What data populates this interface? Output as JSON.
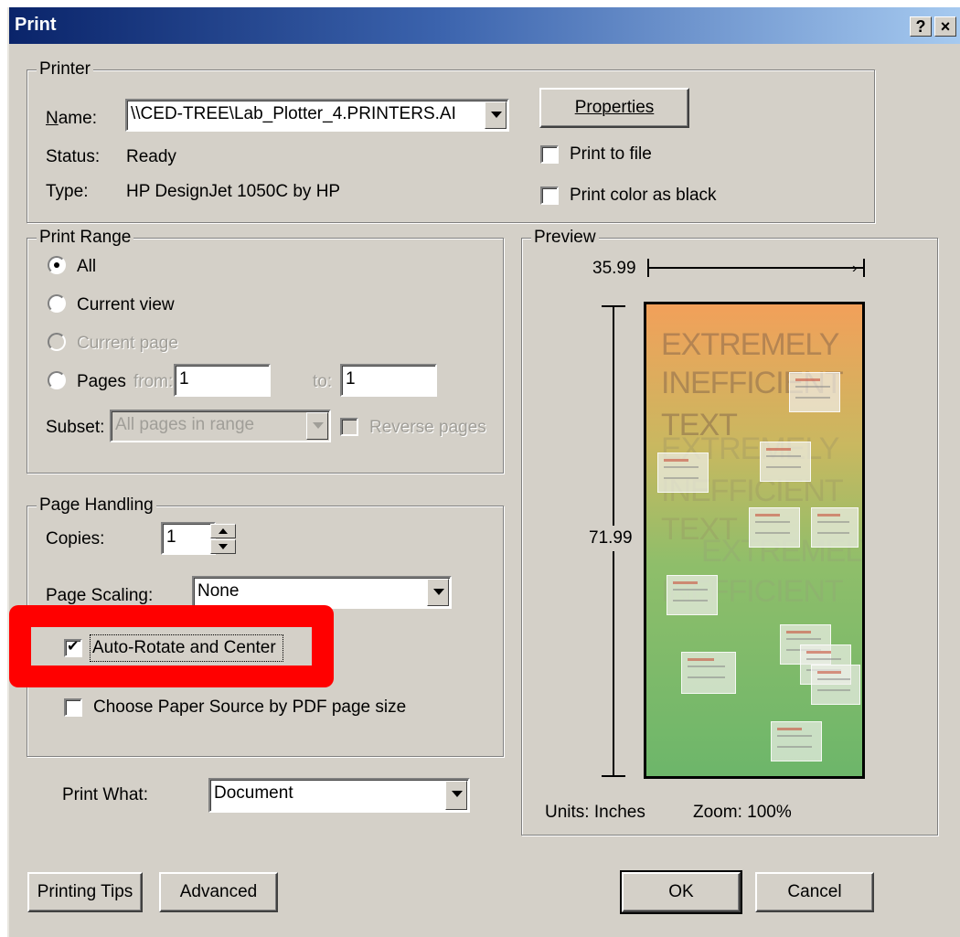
{
  "titlebar": {
    "title": "Print",
    "help_label": "?",
    "close_label": "×"
  },
  "printer": {
    "legend": "Printer",
    "name_label": "Name:",
    "name_value": "\\\\CED-TREE\\Lab_Plotter_4.PRINTERS.AI",
    "status_label": "Status:",
    "status_value": "Ready",
    "type_label": "Type:",
    "type_value": "HP DesignJet 1050C by HP",
    "properties_label": "Properties",
    "print_to_file_label": "Print to file",
    "print_to_file_checked": false,
    "print_color_black_label": "Print color as black",
    "print_color_black_checked": false
  },
  "print_range": {
    "legend": "Print Range",
    "all_label": "All",
    "current_view_label": "Current view",
    "current_page_label": "Current page",
    "pages_label": "Pages",
    "from_label": "from:",
    "from_value": "1",
    "to_label": "to:",
    "to_value": "1",
    "subset_label": "Subset:",
    "subset_value": "All pages in range",
    "reverse_pages_label": "Reverse pages",
    "selected": "All"
  },
  "page_handling": {
    "legend": "Page Handling",
    "copies_label": "Copies:",
    "copies_value": "1",
    "scaling_label": "Page Scaling:",
    "scaling_value": "None",
    "auto_rotate_label": "Auto-Rotate and Center",
    "auto_rotate_checked": true,
    "paper_source_label": "Choose Paper Source by PDF page size",
    "paper_source_checked": false
  },
  "print_what": {
    "label": "Print What:",
    "value": "Document"
  },
  "preview": {
    "legend": "Preview",
    "width_value": "35.99",
    "height_value": "71.99",
    "units_label": "Units: Inches",
    "zoom_label": "Zoom: 100%",
    "poster_lines": [
      "EXTREMELY",
      "INEFFICIENT",
      "TEXT",
      "EXTREMELY",
      "INEFFICIENT",
      "TEXT",
      "EXTREMELY",
      "INEFFICIENT"
    ]
  },
  "footer": {
    "printing_tips_label": "Printing Tips",
    "advanced_label": "Advanced",
    "ok_label": "OK",
    "cancel_label": "Cancel"
  },
  "annotation": {
    "highlight_color": "#ff0000"
  }
}
